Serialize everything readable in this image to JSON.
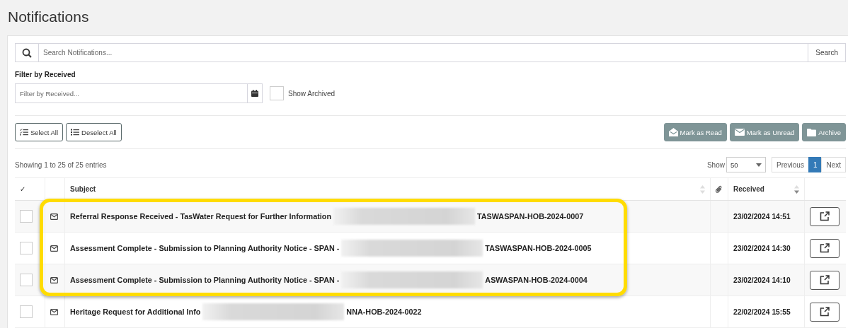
{
  "page": {
    "title": "Notifications"
  },
  "search": {
    "placeholder": "Search Notifications...",
    "button": "Search"
  },
  "filter": {
    "label": "Filter by Received",
    "placeholder": "Filter by Received...",
    "show_archived": {
      "label": "Show Archived",
      "checked": false
    }
  },
  "actions_left": [
    {
      "label": "Select All"
    },
    {
      "label": "Deselect All"
    }
  ],
  "actions_right": [
    {
      "label": "Mark as Read"
    },
    {
      "label": "Mark as Unread"
    },
    {
      "label": "Archive"
    }
  ],
  "info": "Showing 1 to 25 of 25 entries",
  "page_size": {
    "label": "Show",
    "value": "50"
  },
  "pagination": [
    {
      "label": "Previous",
      "selected": false
    },
    {
      "label": "1",
      "selected": true
    },
    {
      "label": "Next",
      "selected": false
    }
  ],
  "table": {
    "columns": [
      {
        "kind": "check",
        "label": "✓"
      },
      {
        "kind": "icon"
      },
      {
        "kind": "subject",
        "label": "Subject"
      },
      {
        "kind": "attachment"
      },
      {
        "kind": "received",
        "label": "Received"
      },
      {
        "kind": "action"
      }
    ],
    "rows": [
      {
        "checked": false,
        "subject_start": "Referral Response Received - TasWater Request for Further Information",
        "subject_end": "TASWASPAN-HOB-2024-0007",
        "received": "23/02/2024 14:51",
        "highlighted": true
      },
      {
        "checked": false,
        "subject_start": "Assessment Complete - Submission to Planning Authority Notice - SPAN -",
        "subject_end": "TASWASPAN-HOB-2024-0005",
        "received": "23/02/2024 14:30",
        "highlighted": true
      },
      {
        "checked": false,
        "subject_start": "Assessment Complete - Submission to Planning Authority Notice - SPAN -",
        "subject_end": "ASWASPAN-HOB-2024-0004",
        "received": "23/02/2024 14:10",
        "highlighted": true
      },
      {
        "checked": false,
        "subject_start": "Heritage Request for Additional Info",
        "subject_end": "NNA-HOB-2024-0022",
        "received": "22/02/2024 15:55",
        "highlighted": false
      }
    ]
  }
}
